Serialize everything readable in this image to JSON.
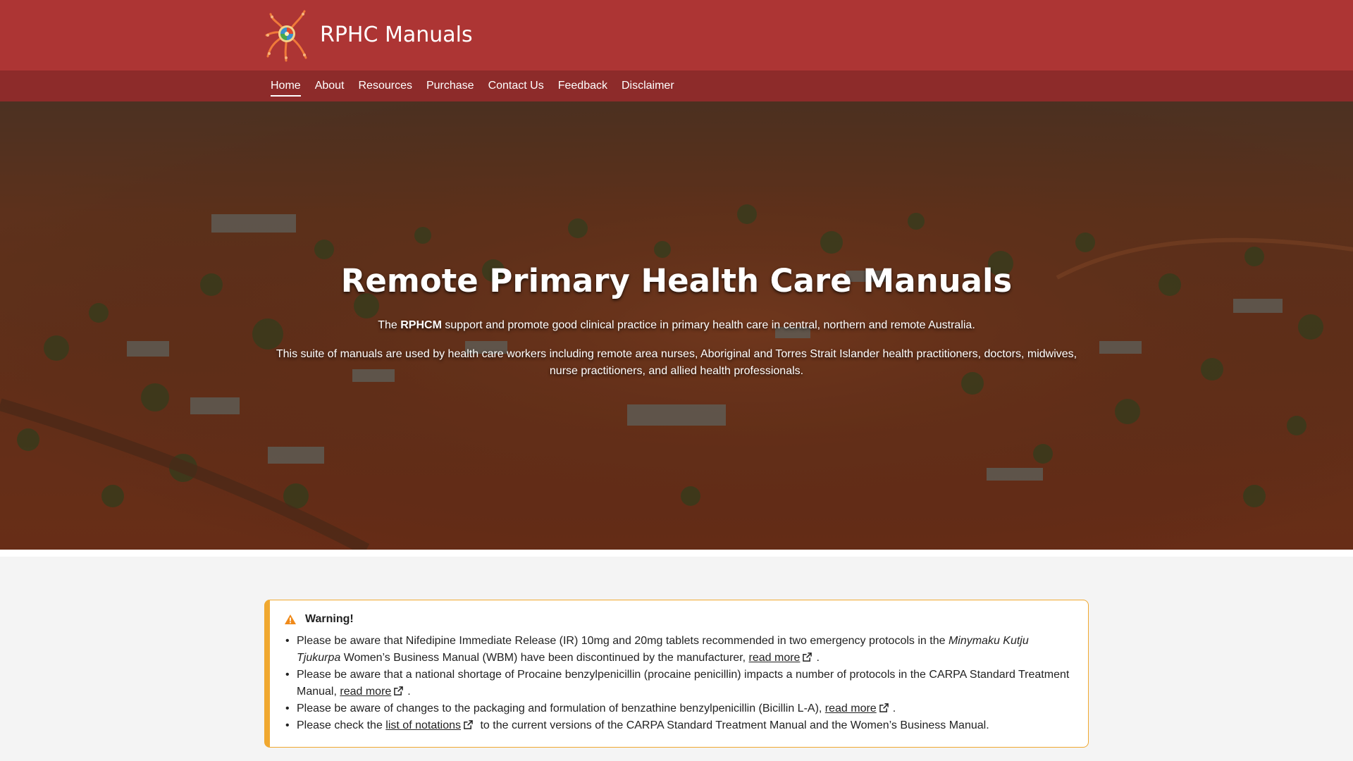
{
  "header": {
    "title": "RPHC Manuals",
    "logo_icon": "dot-painting-logo-icon",
    "bg_color": "#ad3534"
  },
  "nav": {
    "items": [
      "Home",
      "About",
      "Resources",
      "Purchase",
      "Contact Us",
      "Feedback",
      "Disclaimer"
    ],
    "active": "Home",
    "bg_color": "#8d2b2a"
  },
  "hero": {
    "title": "Remote Primary Health Care Manuals",
    "p1_pre": "The ",
    "p1_bold": "RPHCM",
    "p1_post": " support and promote good clinical practice in primary health care in central, northern and remote Australia.",
    "p2": "This suite of manuals are used by health care workers including remote area nurses, Aboriginal and Torres Strait Islander health practitioners, doctors, midwives, nurse practitioners, and allied health professionals."
  },
  "warning": {
    "title": "Warning!",
    "icon": "warning-triangle-icon",
    "accent_color": "#f0a830",
    "items": [
      {
        "pre": "Please be aware that Nifedipine Immediate Release (IR) 10mg and 20mg tablets recommended in two emergency protocols in the ",
        "italic": "Minymaku Kutju Tjukurpa",
        "post": " Women’s Business Manual (WBM) have been discontinued by the manufacturer, ",
        "link": "read more",
        "after": "."
      },
      {
        "pre": "Please be aware that a national shortage of Procaine benzylpenicillin (procaine penicillin) impacts a number of protocols in the CARPA Standard Treatment Manual, ",
        "link": "read more",
        "after": "."
      },
      {
        "pre": "Please be aware of changes to the packaging and formulation of benzathine benzylpenicillin (Bicillin L-A), ",
        "link": "read more",
        "after": "."
      },
      {
        "pre": "Please check the ",
        "link": "list of notations",
        "after": " to the current versions of the CARPA Standard Treatment Manual and the Women’s Business Manual."
      }
    ]
  }
}
